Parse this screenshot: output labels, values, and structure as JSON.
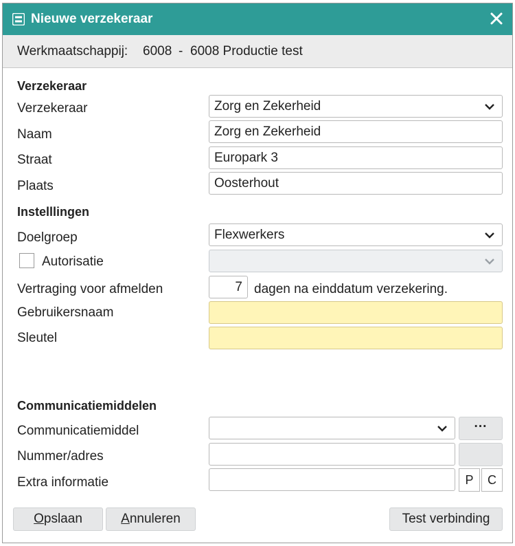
{
  "window": {
    "title": "Nieuwe verzekeraar"
  },
  "company": {
    "label": "Werkmaatschappij:",
    "code": "6008",
    "separator": "-",
    "name": "6008 Productie test"
  },
  "sections": {
    "insurer": "Verzekeraar",
    "settings": "Instelllingen",
    "communication": "Communicatiemiddelen"
  },
  "insurer": {
    "select_label": "Verzekeraar",
    "select_value": "Zorg en Zekerheid",
    "name_label": "Naam",
    "name_value": "Zorg en Zekerheid",
    "street_label": "Straat",
    "street_value": "Europark 3",
    "city_label": "Plaats",
    "city_value": "Oosterhout"
  },
  "settings": {
    "target_group_label": "Doelgroep",
    "target_group_value": "Flexwerkers",
    "authorization_label": "Autorisatie",
    "authorization_checked": false,
    "delay_label": "Vertraging voor afmelden",
    "delay_value": "7",
    "delay_suffix": "dagen na einddatum verzekering.",
    "username_label": "Gebruikersnaam",
    "username_value": "",
    "key_label": "Sleutel",
    "key_value": ""
  },
  "communication": {
    "medium_label": "Communicatiemiddel",
    "medium_value": "",
    "more_label": "···",
    "address_label": "Nummer/adres",
    "address_value": "",
    "extra_label": "Extra informatie",
    "extra_value": "",
    "p_label": "P",
    "c_label": "C"
  },
  "buttons": {
    "save_first": "O",
    "save_rest": "pslaan",
    "cancel_first": "A",
    "cancel_rest": "nnuleren",
    "test": "Test verbinding"
  },
  "colors": {
    "titlebar": "#2e9c97",
    "required_field": "#fff5b8",
    "button": "#e6e7e8"
  }
}
